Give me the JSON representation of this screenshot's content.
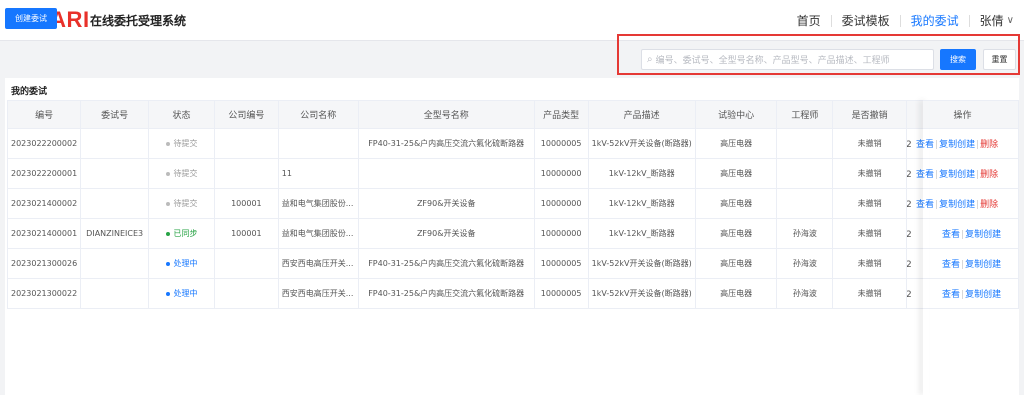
{
  "header": {
    "logo": "XIHARI",
    "system_name": "在线委托受理系统",
    "nav": [
      {
        "label": "首页",
        "active": false
      },
      {
        "label": "委试模板",
        "active": false
      },
      {
        "label": "我的委试",
        "active": true
      }
    ],
    "user": "张倩"
  },
  "toolbar": {
    "create_label": "创建委试",
    "search_placeholder": "编号、委试号、全型号名称、产品型号、产品描述、工程师",
    "search_label": "搜索",
    "reset_label": "重置"
  },
  "panel": {
    "title": "我的委试",
    "columns": [
      "编号",
      "委试号",
      "状态",
      "公司编号",
      "公司名称",
      "全型号名称",
      "产品类型",
      "产品描述",
      "试验中心",
      "工程师",
      "是否撤销",
      "操作"
    ],
    "rows": [
      {
        "id": "2023022200002",
        "wsh": "",
        "status": "待提交",
        "status_type": "gray",
        "company_no": "",
        "company_name": "",
        "model": "FP40-31-25&户内高压交流六氟化硫断路器",
        "product_type": "10000005",
        "desc": "1kV-52kV开关设备(断路器)",
        "center": "高压电器",
        "engineer": "",
        "revoked": "未撤销",
        "pre": "2",
        "ops": [
          "查看",
          "复制创建",
          "删除"
        ]
      },
      {
        "id": "2023022200001",
        "wsh": "",
        "status": "待提交",
        "status_type": "gray",
        "company_no": "",
        "company_name": "11",
        "model": "",
        "product_type": "10000000",
        "desc": "1kV-12kV_断路器",
        "center": "高压电器",
        "engineer": "",
        "revoked": "未撤销",
        "pre": "2",
        "ops": [
          "查看",
          "复制创建",
          "删除"
        ]
      },
      {
        "id": "2023021400002",
        "wsh": "",
        "status": "待提交",
        "status_type": "gray",
        "company_no": "100001",
        "company_name": "益和电气集团股份...",
        "model": "ZF90&开关设备",
        "product_type": "10000000",
        "desc": "1kV-12kV_断路器",
        "center": "高压电器",
        "engineer": "",
        "revoked": "未撤销",
        "pre": "2",
        "ops": [
          "查看",
          "复制创建",
          "删除"
        ]
      },
      {
        "id": "2023021400001",
        "wsh": "DIANZINEICE3",
        "status": "已同步",
        "status_type": "green",
        "company_no": "100001",
        "company_name": "益和电气集团股份...",
        "model": "ZF90&开关设备",
        "product_type": "10000000",
        "desc": "1kV-12kV_断路器",
        "center": "高压电器",
        "engineer": "孙海波",
        "revoked": "未撤销",
        "pre": "2",
        "ops": [
          "查看",
          "复制创建"
        ]
      },
      {
        "id": "2023021300026",
        "wsh": "",
        "status": "处理中",
        "status_type": "blue",
        "company_no": "",
        "company_name": "西安西电高压开关...",
        "model": "FP40-31-25&户内高压交流六氟化硫断路器",
        "product_type": "10000005",
        "desc": "1kV-52kV开关设备(断路器)",
        "center": "高压电器",
        "engineer": "孙海波",
        "revoked": "未撤销",
        "pre": "2",
        "ops": [
          "查看",
          "复制创建"
        ]
      },
      {
        "id": "2023021300022",
        "wsh": "",
        "status": "处理中",
        "status_type": "blue",
        "company_no": "",
        "company_name": "西安西电高压开关...",
        "model": "FP40-31-25&户内高压交流六氟化硫断路器",
        "product_type": "10000005",
        "desc": "1kV-52kV开关设备(断路器)",
        "center": "高压电器",
        "engineer": "孙海波",
        "revoked": "未撤销",
        "pre": "2",
        "ops": [
          "查看",
          "复制创建"
        ]
      }
    ]
  },
  "colors": {
    "accent": "#1677ff",
    "brand": "#e8312a",
    "danger": "#e53935",
    "success": "#27a345"
  }
}
